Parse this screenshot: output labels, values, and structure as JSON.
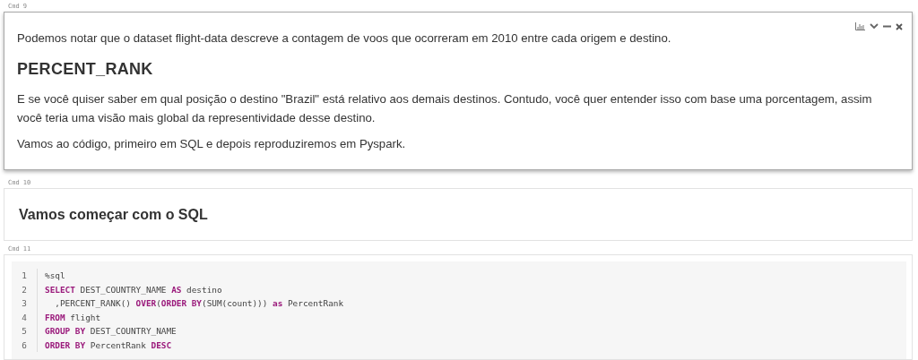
{
  "cells": [
    {
      "label": "Cmd 9",
      "kind": "markdown",
      "focused": true,
      "blocks": [
        {
          "kind": "p",
          "text": "Podemos notar que o dataset flight-data descreve a contagem de voos que ocorreram em 2010 entre cada origem e destino."
        },
        {
          "kind": "h2",
          "text": "PERCENT_RANK"
        },
        {
          "kind": "p",
          "text": "E se você quiser saber em qual posição o destino \"Brazil\" está relativo aos demais destinos. Contudo, você quer entender isso com base uma porcentagem, assim você teria uma visão mais global da representividade desse destino."
        },
        {
          "kind": "p",
          "text": "Vamos ao código, primeiro em SQL e depois reproduziremos em Pyspark."
        }
      ]
    },
    {
      "label": "Cmd 10",
      "kind": "markdown",
      "focused": false,
      "blocks": [
        {
          "kind": "h3",
          "text": "Vamos começar com o SQL"
        }
      ]
    },
    {
      "label": "Cmd 11",
      "kind": "code",
      "focused": false,
      "lines": [
        {
          "number": "1",
          "tokens": [
            {
              "kind": "plain",
              "text": "%sql"
            }
          ]
        },
        {
          "number": "2",
          "tokens": [
            {
              "kind": "keyword",
              "text": "SELECT"
            },
            {
              "kind": "plain",
              "text": " DEST_COUNTRY_NAME "
            },
            {
              "kind": "keyword",
              "text": "AS"
            },
            {
              "kind": "plain",
              "text": " destino"
            }
          ]
        },
        {
          "number": "3",
          "tokens": [
            {
              "kind": "plain",
              "text": "  ,PERCENT_RANK() "
            },
            {
              "kind": "keyword",
              "text": "OVER"
            },
            {
              "kind": "plain",
              "text": "("
            },
            {
              "kind": "keyword",
              "text": "ORDER BY"
            },
            {
              "kind": "plain",
              "text": "(SUM(count))) "
            },
            {
              "kind": "keyword",
              "text": "as"
            },
            {
              "kind": "plain",
              "text": " PercentRank"
            }
          ]
        },
        {
          "number": "4",
          "tokens": [
            {
              "kind": "keyword",
              "text": "FROM"
            },
            {
              "kind": "plain",
              "text": " flight"
            }
          ]
        },
        {
          "number": "5",
          "tokens": [
            {
              "kind": "keyword",
              "text": "GROUP BY"
            },
            {
              "kind": "plain",
              "text": " DEST_COUNTRY_NAME"
            }
          ]
        },
        {
          "number": "6",
          "tokens": [
            {
              "kind": "keyword",
              "text": "ORDER BY"
            },
            {
              "kind": "plain",
              "text": " PercentRank "
            },
            {
              "kind": "keyword",
              "text": "DESC"
            }
          ]
        }
      ]
    }
  ]
}
